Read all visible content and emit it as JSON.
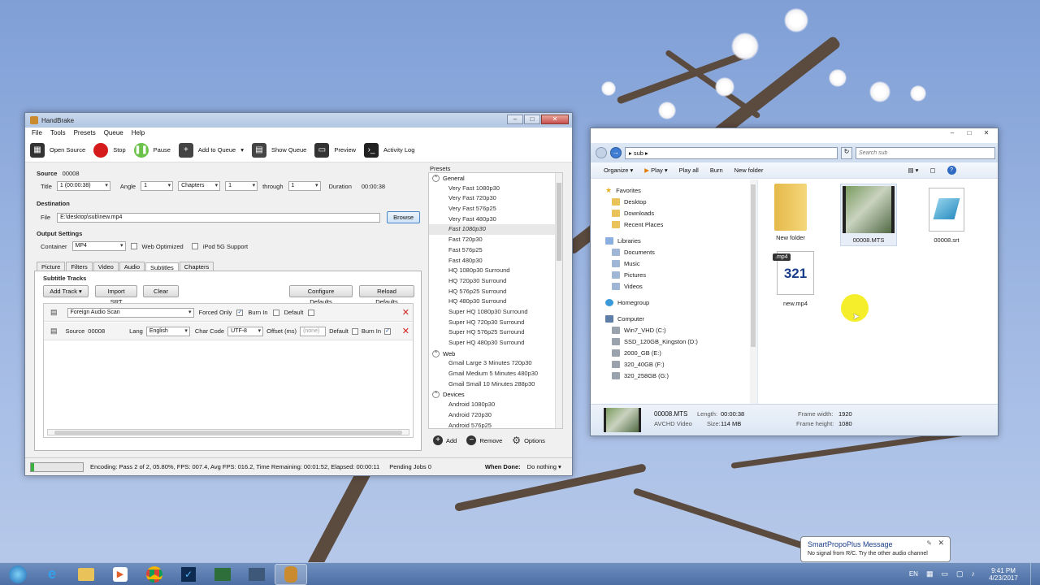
{
  "handbrake": {
    "title": "HandBrake",
    "menu": [
      "File",
      "Tools",
      "Presets",
      "Queue",
      "Help"
    ],
    "toolbar": {
      "open_source": "Open Source",
      "stop": "Stop",
      "pause": "Pause",
      "add_to_queue": "Add to Queue",
      "show_queue": "Show Queue",
      "preview": "Preview",
      "activity_log": "Activity Log"
    },
    "source": {
      "label": "Source",
      "value": "00008"
    },
    "title_label": "Title",
    "title_value": "1 (00:00:38)",
    "angle_label": "Angle",
    "angle_value": "1",
    "range_mode": "Chapters",
    "range_start": "1",
    "through_label": "through",
    "range_end": "1",
    "duration_label": "Duration",
    "duration_value": "00:00:38",
    "destination_label": "Destination",
    "file_label": "File",
    "file_value": "E:\\desktop\\sub\\new.mp4",
    "browse": "Browse",
    "output_settings_label": "Output Settings",
    "container_label": "Container",
    "container_value": "MP4",
    "web_optimized": "Web Optimized",
    "ipod_support": "iPod 5G Support",
    "tabs": [
      "Picture",
      "Filters",
      "Video",
      "Audio",
      "Subtitles",
      "Chapters"
    ],
    "active_tab": "Subtitles",
    "subtitle_tracks_label": "Subtitle Tracks",
    "add_track": "Add Track",
    "import_srt": "Import SRT",
    "clear": "Clear",
    "configure_defaults": "Configure Defaults",
    "reload_defaults": "Reload Defaults",
    "track1": {
      "source": "Foreign Audio Scan",
      "forced_only": "Forced Only",
      "burn_in": "Burn In",
      "default": "Default"
    },
    "track2": {
      "source_label": "Source",
      "source_value": "00008",
      "lang_label": "Lang",
      "lang_value": "English",
      "charcode_label": "Char Code",
      "charcode_value": "UTF-8",
      "offset_label": "Offset (ms)",
      "offset_placeholder": "(none)",
      "default": "Default",
      "burn_in": "Burn In"
    },
    "presets_label": "Presets",
    "presets": {
      "general": {
        "name": "General",
        "items": [
          "Very Fast 1080p30",
          "Very Fast 720p30",
          "Very Fast 576p25",
          "Very Fast 480p30",
          "Fast 1080p30",
          "Fast 720p30",
          "Fast 576p25",
          "Fast 480p30",
          "HQ 1080p30 Surround",
          "HQ 720p30 Surround",
          "HQ 576p25 Surround",
          "HQ 480p30 Surround",
          "Super HQ 1080p30 Surround",
          "Super HQ 720p30 Surround",
          "Super HQ 576p25 Surround",
          "Super HQ 480p30 Surround"
        ]
      },
      "web": {
        "name": "Web",
        "items": [
          "Gmail Large 3 Minutes 720p30",
          "Gmail Medium 5 Minutes 480p30",
          "Gmail Small 10 Minutes 288p30"
        ]
      },
      "devices": {
        "name": "Devices",
        "items": [
          "Android 1080p30",
          "Android 720p30",
          "Android 576p25"
        ]
      },
      "selected": "Fast 1080p30"
    },
    "preset_add": "Add",
    "preset_remove": "Remove",
    "preset_options": "Options",
    "status": "Encoding: Pass 2 of 2,  05.80%, FPS: 007.4,  Avg FPS: 016.2,  Time Remaining: 00:01:52,  Elapsed: 00:00:11",
    "pending": "Pending Jobs 0",
    "progress": 0.058,
    "when_done_label": "When Done:",
    "when_done_value": "Do nothing"
  },
  "explorer": {
    "path": "sub",
    "search_placeholder": "Search sub",
    "commands": [
      "Organize",
      "Play",
      "Play all",
      "Burn",
      "New folder"
    ],
    "nav": {
      "favorites": "Favorites",
      "fav_items": [
        "Desktop",
        "Downloads",
        "Recent Places"
      ],
      "libraries": "Libraries",
      "lib_items": [
        "Documents",
        "Music",
        "Pictures",
        "Videos"
      ],
      "homegroup": "Homegroup",
      "computer": "Computer",
      "drives": [
        "Win7_VHD (C:)",
        "SSD_120GB_Kingston (D:)",
        "2000_GB (E:)",
        "320_40GB (F:)",
        "320_258GB (G:)"
      ]
    },
    "files": [
      {
        "name": "New folder",
        "icon": "folder-icon"
      },
      {
        "name": "00008.MTS",
        "icon": "video-thumbnail-icon"
      },
      {
        "name": "00008.srt",
        "icon": "document-icon"
      },
      {
        "name": "new.mp4",
        "icon": "media-player-icon",
        "badge": ".mp4"
      }
    ],
    "details": {
      "name": "00008.MTS",
      "type": "AVCHD Video",
      "length_label": "Length:",
      "length": "00:00:38",
      "size_label": "Size:",
      "size": "114 MB",
      "fw_label": "Frame width:",
      "fw": "1920",
      "fh_label": "Frame height:",
      "fh": "1080"
    }
  },
  "notification": {
    "title": "SmartPropoPlus Message",
    "body": "No signal from R/C. Try the other audio channel"
  },
  "tray": {
    "lang": "EN",
    "time": "9:41 PM",
    "date": "4/23/2017"
  }
}
